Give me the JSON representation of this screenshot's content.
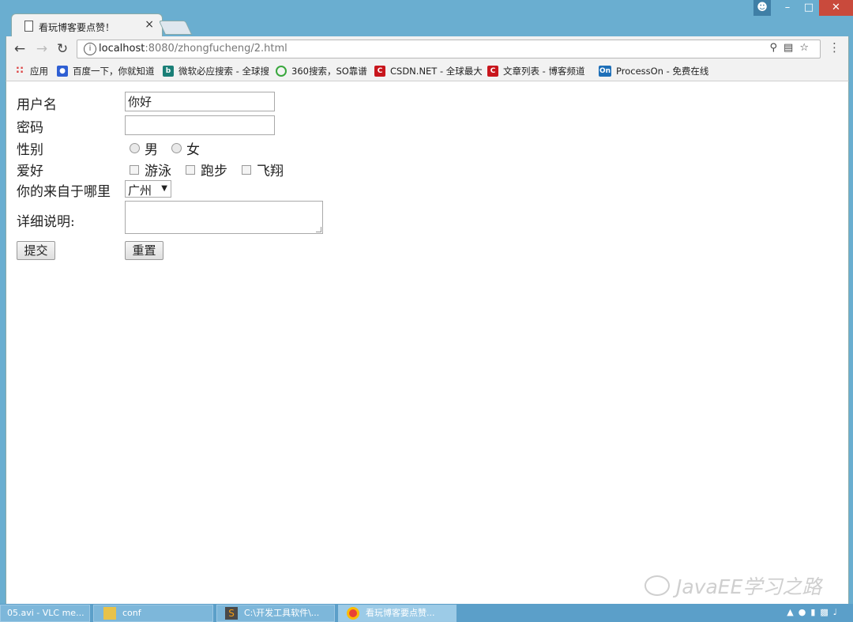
{
  "browser": {
    "tab_title": "看玩博客要点赞！",
    "tab_close": "×",
    "url_host": "localhost",
    "url_rest": ":8080/zhongfucheng/2.html",
    "bookmarks": [
      {
        "label": "应用",
        "icon": "apps-grid-icon",
        "color": "#d44"
      },
      {
        "label": "百度一下，你就知道",
        "icon": "baidu-paw-icon",
        "color": "#2f5fd3"
      },
      {
        "label": "微软必应搜索 - 全球搜",
        "icon": "bing-icon",
        "color": "#1a7f77"
      },
      {
        "label": "360搜索，SO靠谱",
        "icon": "360-search-icon",
        "color": "#39a73d"
      },
      {
        "label": "CSDN.NET - 全球最大",
        "icon": "csdn-icon",
        "color": "#c8161d"
      },
      {
        "label": "文章列表 - 博客频道",
        "icon": "csdn-blog-icon",
        "color": "#c8161d"
      },
      {
        "label": "ProcessOn - 免费在线",
        "icon": "processon-icon",
        "color": "#1e6fb8"
      }
    ]
  },
  "form": {
    "username_label": "用户名",
    "username_value": "你好",
    "password_label": "密码",
    "gender_label": "性别",
    "gender_options": [
      "男",
      "女"
    ],
    "hobby_label": "爱好",
    "hobby_options": [
      "游泳",
      "跑步",
      "飞翔"
    ],
    "origin_label": "你的来自于哪里",
    "origin_selected": "广州",
    "detail_label": "详细说明:",
    "submit_label": "提交",
    "reset_label": "重置"
  },
  "watermark": "JavaEE学习之路",
  "taskbar": {
    "items": [
      {
        "label": "05.avi - VLC me..."
      },
      {
        "label": "conf"
      },
      {
        "label": "C:\\开发工具软件\\..."
      },
      {
        "label": "看玩博客要点赞..."
      }
    ]
  }
}
